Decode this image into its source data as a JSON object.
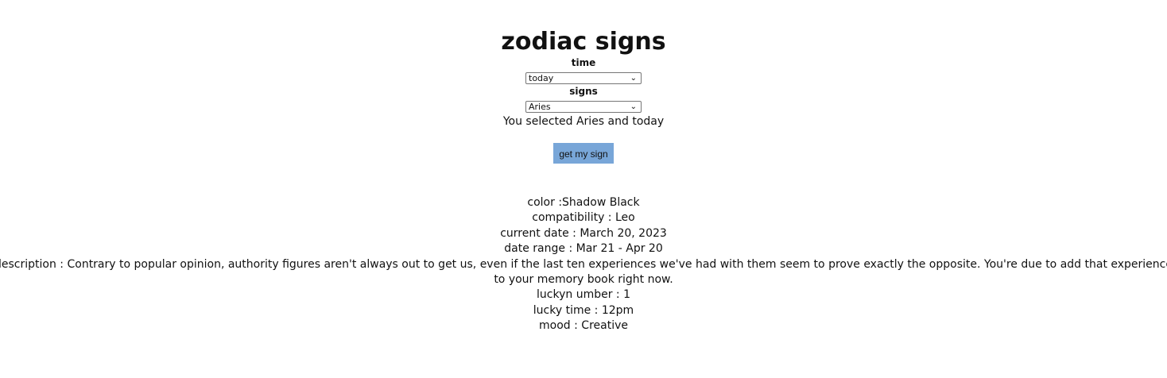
{
  "page": {
    "title": "zodiac signs"
  },
  "form": {
    "time_label": "time",
    "time_value": "today",
    "signs_label": "signs",
    "signs_value": "Aries",
    "selected_message": "You selected Aries and today",
    "submit_label": "get my sign",
    "submit_color": "#78a6d8"
  },
  "result": {
    "color": "color :Shadow Black",
    "compatibility": "compatibility : Leo",
    "current_date": "current date : March 20, 2023",
    "date_range": "date range : Mar 21 - Apr 20",
    "description": "description : Contrary to popular opinion, authority figures aren't always out to get us, even if the last ten experiences we've had with them seem to prove exactly the opposite. You're due to add that experience to your memory book right now.",
    "lucky_number": "luckyn umber : 1",
    "lucky_time": "lucky time : 12pm",
    "mood": "mood : Creative"
  }
}
